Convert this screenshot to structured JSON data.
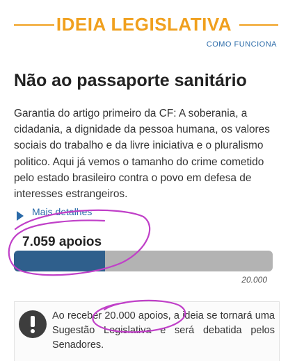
{
  "header": {
    "title": "IDEIA LEGISLATIVA",
    "accent_color": "#f0a01e"
  },
  "nav": {
    "how_it_works": "COMO FUNCIONA"
  },
  "idea": {
    "title": "Não ao passaporte sanitário",
    "description": "Garantia do artigo primeiro da CF: A soberania, a cidadania, a dignidade da pessoa humana, os valores sociais do trabalho e da livre iniciativa e o pluralismo politico. Aqui já vemos o tamanho do crime cometido pelo estado brasileiro contra o povo em defesa de interesses estrangeiros.",
    "more_details": "Mais detalhes"
  },
  "support": {
    "count_label": "7.059 apoios",
    "count": 7059,
    "goal": 20000,
    "goal_label": "20.000",
    "progress_fraction": 0.353,
    "bar_color": "#2f5f8c",
    "track_color": "#b3b3b3"
  },
  "notice": {
    "icon": "exclamation-icon",
    "text": "Ao receber 20.000 apoios, a ideia se tornará uma Sugestão Legislativa e será debatida pelos Senadores."
  },
  "annotation": {
    "color": "#c040c8"
  }
}
